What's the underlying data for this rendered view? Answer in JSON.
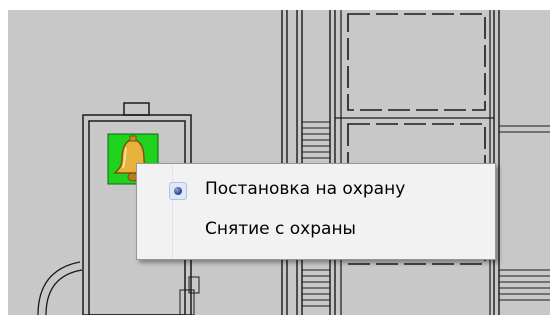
{
  "context_menu": {
    "items": [
      {
        "label": "Постановка на охрану",
        "checked": true
      },
      {
        "label": "Снятие с охраны",
        "checked": false
      }
    ]
  },
  "map": {
    "background_color": "#c8c8c8",
    "line_color": "#1a1a1a",
    "marker": {
      "icon": "bell-icon",
      "status_color": "#1ed21e",
      "icon_color": "#e6b23c"
    }
  }
}
